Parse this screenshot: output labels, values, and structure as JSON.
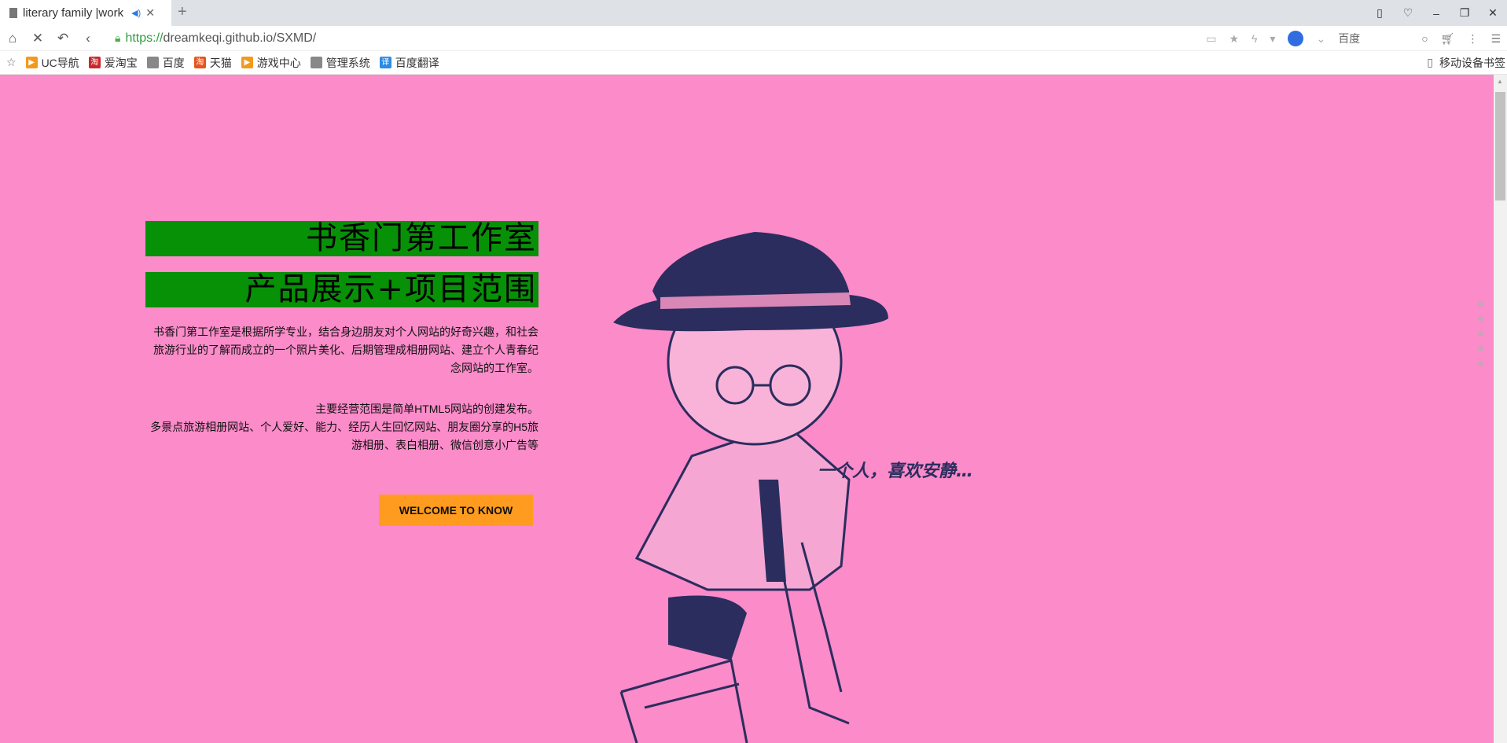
{
  "browser": {
    "tab_title": "literary family |work",
    "url_scheme": "https://",
    "url_rest": "dreamkeqi.github.io/SXMD/",
    "search_engine": "百度",
    "bookmarks": [
      {
        "label": "UC导航",
        "color": "#f39a1e",
        "glyph": "▶"
      },
      {
        "label": "爱淘宝",
        "color": "#c9282d",
        "glyph": "淘"
      },
      {
        "label": "百度",
        "color": "#888888",
        "glyph": ""
      },
      {
        "label": "天猫",
        "color": "#e8541e",
        "glyph": "淘"
      },
      {
        "label": "游戏中心",
        "color": "#f39a1e",
        "glyph": "▶"
      },
      {
        "label": "管理系统",
        "color": "#888888",
        "glyph": ""
      },
      {
        "label": "百度翻译",
        "color": "#2b8be6",
        "glyph": "译"
      }
    ],
    "mobile_bookmarks": "移动设备书签"
  },
  "page": {
    "background": "#fb8bc9",
    "heading1": "书香门第工作室",
    "heading2": "产品展示+项目范围",
    "intro": "书香门第工作室是根据所学专业，结合身边朋友对个人网站的好奇兴趣，和社会旅游行业的了解而成立的一个照片美化、后期管理成相册网站、建立个人青春纪念网站的工作室。",
    "scope_line1": "主要经营范围是简单HTML5网站的创建发布。",
    "scope_line2": "多景点旅游相册网站、个人爱好、能力、经历人生回忆网站、朋友圈分享的H5旅游相册、表白相册、微信创意小广告等",
    "button": "WELCOME TO KNOW",
    "image_caption": "一个人，喜欢安静…",
    "nav_dots": 5
  }
}
